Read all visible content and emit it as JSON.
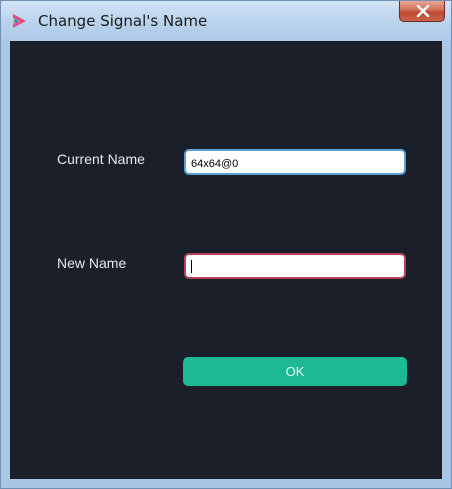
{
  "window": {
    "title": "Change Signal's Name",
    "app_icon": "app-logo-icon",
    "close_icon": "close-icon"
  },
  "form": {
    "current_name_label": "Current Name",
    "current_name_value": "64x64@0",
    "new_name_label": "New Name",
    "new_name_value": "",
    "ok_label": "OK"
  },
  "colors": {
    "background": "#1b1f2a",
    "accent_button": "#1fb894",
    "focused_field_border": "#b7405c",
    "field_border": "#5a9fd6"
  }
}
